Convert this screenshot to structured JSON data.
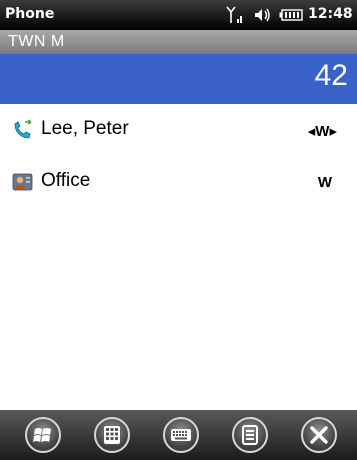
{
  "status_bar": {
    "app_name": "Phone",
    "time": "12:48",
    "icons": [
      "signal-icon",
      "speaker-icon",
      "battery-icon"
    ]
  },
  "dialer": {
    "letters": "TWN M",
    "digits": "42",
    "accent_color": "#3a62c9"
  },
  "matches": [
    {
      "name": "Lee, Peter",
      "type": "W",
      "icon": "phone-call-icon"
    },
    {
      "name": "Office",
      "type": "W",
      "icon": "contact-card-icon"
    }
  ],
  "toolbar": {
    "buttons": [
      "windows-start-icon",
      "keypad-icon",
      "keyboard-icon",
      "menu-icon",
      "close-icon"
    ]
  }
}
